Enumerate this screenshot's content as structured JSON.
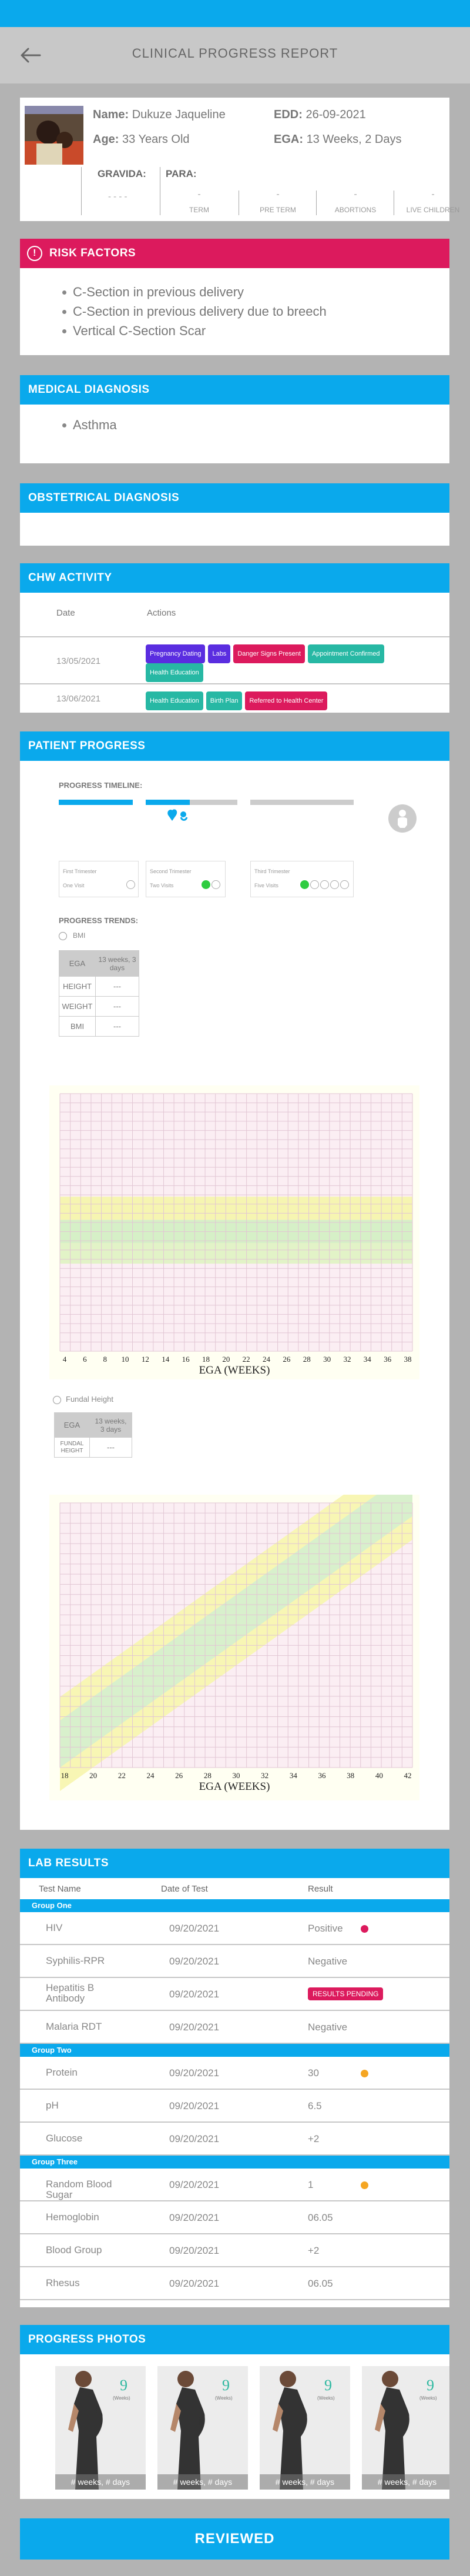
{
  "header": {
    "title": "CLINICAL PROGRESS REPORT"
  },
  "patient": {
    "name_label": "Name:",
    "name": "Dukuze Jaqueline",
    "age_label": "Age:",
    "age": "33 Years Old",
    "edd_label": "EDD:",
    "edd": "26-09-2021",
    "ega_label": "EGA:",
    "ega": "13 Weeks, 2 Days",
    "gravida_label": "GRAVIDA:",
    "gravida_value": "- - - -",
    "para_label": "PARA:",
    "para": [
      {
        "value": "-",
        "label": "TERM"
      },
      {
        "value": "-",
        "label": "PRE TERM"
      },
      {
        "value": "-",
        "label": "ABORTIONS"
      },
      {
        "value": "-",
        "label": "LIVE CHILDREN"
      }
    ]
  },
  "risk": {
    "title": "RISK FACTORS",
    "items": [
      "C-Section in previous delivery",
      "C-Section in previous delivery due to breech",
      "Vertical C-Section Scar"
    ]
  },
  "medical": {
    "title": "MEDICAL DIAGNOSIS",
    "items": [
      "Asthma"
    ]
  },
  "obstetrical": {
    "title": "OBSTETRICAL DIAGNOSIS"
  },
  "chw": {
    "title": "CHW ACTIVITY",
    "col_date": "Date",
    "col_actions": "Actions",
    "rows": [
      {
        "date": "13/05/2021",
        "tags": [
          {
            "label": "Pregnancy Dating",
            "color": "#5a2de0"
          },
          {
            "label": "Labs",
            "color": "#5a2de0"
          },
          {
            "label": "Danger Signs Present",
            "color": "#dc1a5d"
          },
          {
            "label": "Appointment Confirmed",
            "color": "#27b8a4"
          },
          {
            "label": "Health Education",
            "color": "#27b8a4"
          }
        ]
      },
      {
        "date": "13/06/2021",
        "tags": [
          {
            "label": "Health Education",
            "color": "#27b8a4"
          },
          {
            "label": "Birth Plan",
            "color": "#27b8a4"
          },
          {
            "label": "Referred to Health Center",
            "color": "#dc1a5d"
          }
        ]
      }
    ]
  },
  "progress": {
    "title": "PATIENT PROGRESS",
    "timeline_label": "PROGRESS TIMELINE:",
    "trimesters": [
      {
        "name": "First Trimester",
        "visit": "One Visit",
        "visits_total": 1,
        "visits_done": 0
      },
      {
        "name": "Second Trimester",
        "visit": "Two Visits",
        "visits_total": 2,
        "visits_done": 1
      },
      {
        "name": "Third Trimester",
        "visit": "Five Visits",
        "visits_total": 5,
        "visits_done": 1
      }
    ],
    "trimester_fill": [
      1,
      0.48,
      0
    ],
    "trends_label": "PROGRESS TRENDS:",
    "bmi": {
      "radio_label": "BMI",
      "table_head": [
        "EGA",
        "13 weeks, 3 days"
      ],
      "table_rows": [
        [
          "HEIGHT",
          "---"
        ],
        [
          "WEIGHT",
          "---"
        ],
        [
          "BMI",
          "---"
        ]
      ],
      "x_ticks": [
        "4",
        "6",
        "8",
        "10",
        "12",
        "14",
        "16",
        "18",
        "20",
        "22",
        "24",
        "26",
        "28",
        "30",
        "32",
        "34",
        "36",
        "38"
      ],
      "xlabel": "EGA (WEEKS)"
    },
    "fundal": {
      "radio_label": "Fundal Height",
      "table_head": [
        "EGA",
        "13 weeks, 3 days"
      ],
      "table_rows": [
        [
          "FUNDAL HEIGHT",
          "---"
        ]
      ],
      "x_ticks": [
        "18",
        "20",
        "22",
        "24",
        "26",
        "28",
        "30",
        "32",
        "34",
        "36",
        "38",
        "40",
        "42"
      ],
      "xlabel": "EGA (WEEKS)"
    }
  },
  "labs": {
    "title": "LAB RESULTS",
    "col_test": "Test Name",
    "col_date": "Date of Test",
    "col_result": "Result",
    "groups": [
      {
        "name": "Group One",
        "rows": [
          {
            "test": "HIV",
            "date": "09/20/2021",
            "result": "Positive",
            "flag": "#dc1a5d"
          },
          {
            "test": "Syphilis-RPR",
            "date": "09/20/2021",
            "result": "Negative",
            "flag": ""
          },
          {
            "test": "Hepatitis B Antibody",
            "date": "09/20/2021",
            "result": "RESULTS PENDING",
            "flag": "badge"
          },
          {
            "test": "Malaria RDT",
            "date": "09/20/2021",
            "result": "Negative",
            "flag": ""
          }
        ]
      },
      {
        "name": "Group Two",
        "rows": [
          {
            "test": "Protein",
            "date": "09/20/2021",
            "result": "30",
            "flag": "#f5a623"
          },
          {
            "test": "pH",
            "date": "09/20/2021",
            "result": "6.5",
            "flag": ""
          },
          {
            "test": "Glucose",
            "date": "09/20/2021",
            "result": "+2",
            "flag": ""
          }
        ]
      },
      {
        "name": "Group Three",
        "rows": [
          {
            "test": "Random Blood Sugar",
            "date": "09/20/2021",
            "result": "1",
            "flag": "#f5a623"
          },
          {
            "test": "Hemoglobin",
            "date": "09/20/2021",
            "result": "06.05",
            "flag": ""
          },
          {
            "test": "Blood Group",
            "date": "09/20/2021",
            "result": "+2",
            "flag": ""
          },
          {
            "test": "Rhesus",
            "date": "09/20/2021",
            "result": "06.05",
            "flag": ""
          }
        ]
      }
    ]
  },
  "photos": {
    "title": "PROGRESS PHOTOS",
    "items": [
      {
        "caption": "# weeks, # days",
        "number": "9",
        "unit": "(Weeks)"
      },
      {
        "caption": "# weeks, # days",
        "number": "9",
        "unit": "(Weeks)"
      },
      {
        "caption": "# weeks, # days",
        "number": "9",
        "unit": "(Weeks)"
      },
      {
        "caption": "# weeks, # days",
        "number": "9",
        "unit": "(Weeks)"
      }
    ]
  },
  "reviewed_button": "REVIEWED",
  "colors": {
    "accent": "#0aa9ec",
    "danger": "#dc1a5d",
    "ok": "#2ecc40",
    "warn": "#f5a623",
    "purple": "#5a2de0",
    "teal": "#27b8a4"
  }
}
